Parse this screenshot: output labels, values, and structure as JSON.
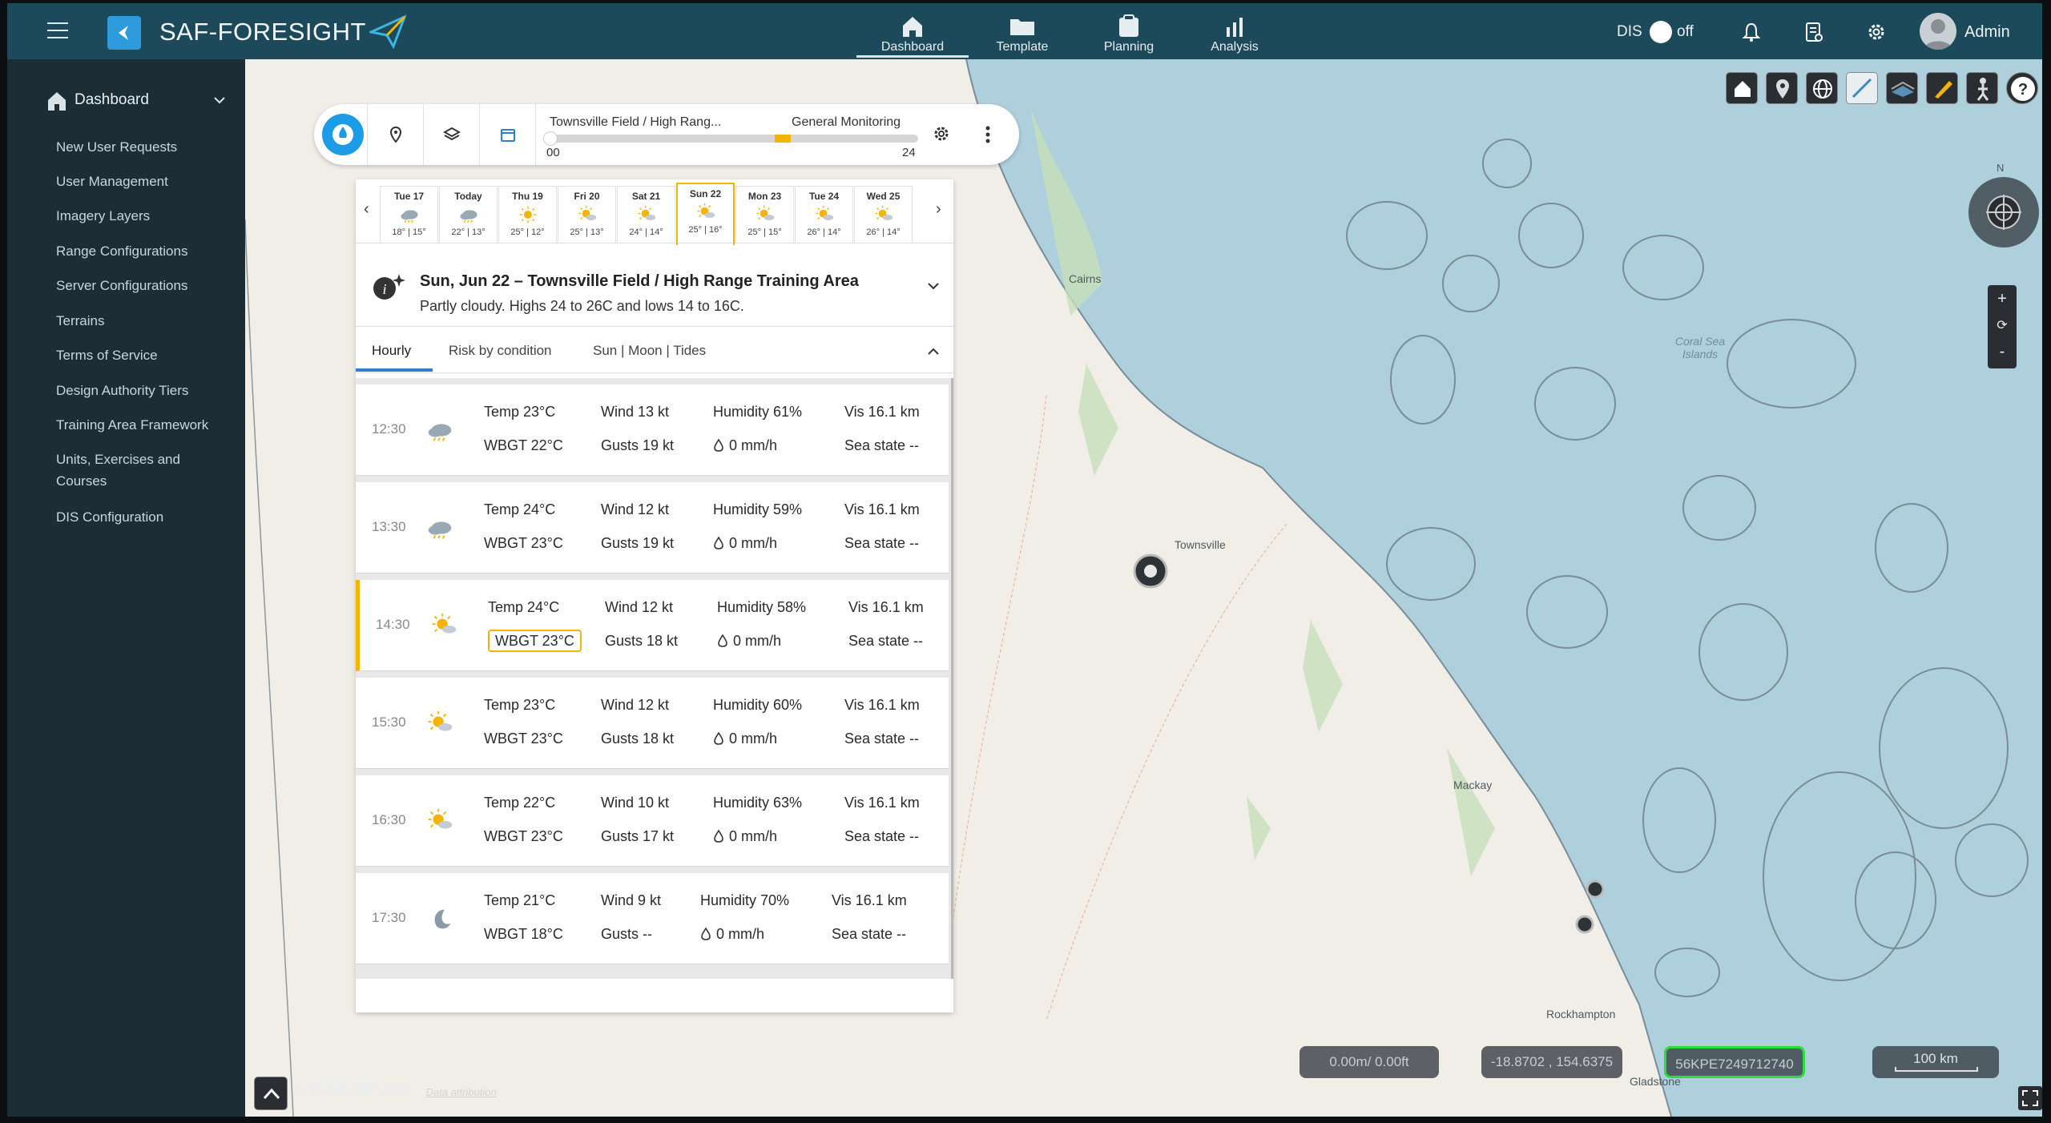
{
  "header": {
    "app_title": "SAF-FORESIGHT",
    "nav": [
      {
        "label": "Dashboard",
        "icon": "home-icon",
        "active": true
      },
      {
        "label": "Template",
        "icon": "folder-icon",
        "active": false
      },
      {
        "label": "Planning",
        "icon": "clipboard-icon",
        "active": false
      },
      {
        "label": "Analysis",
        "icon": "bar-chart-icon",
        "active": false
      }
    ],
    "dis_label": "DIS",
    "dis_toggle": "off",
    "user": "Admin"
  },
  "sidebar": {
    "section": "Dashboard",
    "items": [
      "New User Requests",
      "User Management",
      "Imagery Layers",
      "Range Configurations",
      "Server Configurations",
      "Terrains",
      "Terms of Service",
      "Design Authority Tiers",
      "Training Area Framework",
      "Units, Exercises and Courses",
      "DIS Configuration"
    ]
  },
  "controls": {
    "range_name": "Townsville Field / High Rang...",
    "mode": "General Monitoring",
    "slider_start": "00",
    "slider_end": "24"
  },
  "days": [
    {
      "label": "Tue 17",
      "temps": "18° | 15°",
      "icon": "cloud-icon"
    },
    {
      "label": "Today",
      "temps": "22° | 13°",
      "icon": "cloud-icon"
    },
    {
      "label": "Thu 19",
      "temps": "25° | 12°",
      "icon": "sun-icon"
    },
    {
      "label": "Fri 20",
      "temps": "25° | 13°",
      "icon": "partly-cloudy-icon"
    },
    {
      "label": "Sat 21",
      "temps": "24° | 14°",
      "icon": "partly-cloudy-icon"
    },
    {
      "label": "Sun 22",
      "temps": "25° | 16°",
      "icon": "partly-cloudy-icon",
      "selected": true
    },
    {
      "label": "Mon 23",
      "temps": "25° | 15°",
      "icon": "partly-cloudy-icon"
    },
    {
      "label": "Tue 24",
      "temps": "26° | 14°",
      "icon": "partly-cloudy-icon"
    },
    {
      "label": "Wed 25",
      "temps": "26° | 14°",
      "icon": "partly-cloudy-icon"
    }
  ],
  "summary": {
    "title": "Sun, Jun 22 – Townsville Field / High Range Training Area",
    "desc": "Partly cloudy. Highs 24 to 26C and lows 14 to 16C."
  },
  "tabs": [
    "Hourly",
    "Risk by condition",
    "Sun | Moon | Tides"
  ],
  "hourly": [
    {
      "time": "12:30",
      "temp": "Temp 23°C",
      "wbgt": "WBGT 22°C",
      "wind": "Wind 13 kt",
      "gusts": "Gusts 19 kt",
      "humidity": "Humidity 61%",
      "rain": "0 mm/h",
      "vis": "Vis 16.1 km",
      "sea": "Sea state --"
    },
    {
      "time": "13:30",
      "temp": "Temp 24°C",
      "wbgt": "WBGT 23°C",
      "wind": "Wind 12 kt",
      "gusts": "Gusts 19 kt",
      "humidity": "Humidity 59%",
      "rain": "0 mm/h",
      "vis": "Vis 16.1 km",
      "sea": "Sea state --"
    },
    {
      "time": "14:30",
      "temp": "Temp 24°C",
      "wbgt": "WBGT 23°C",
      "wind": "Wind 12 kt",
      "gusts": "Gusts 18 kt",
      "humidity": "Humidity 58%",
      "rain": "0 mm/h",
      "vis": "Vis 16.1 km",
      "sea": "Sea state --",
      "selected": true
    },
    {
      "time": "15:30",
      "temp": "Temp 23°C",
      "wbgt": "WBGT 23°C",
      "wind": "Wind 12 kt",
      "gusts": "Gusts 18 kt",
      "humidity": "Humidity 60%",
      "rain": "0 mm/h",
      "vis": "Vis 16.1 km",
      "sea": "Sea state --"
    },
    {
      "time": "16:30",
      "temp": "Temp 22°C",
      "wbgt": "WBGT 23°C",
      "wind": "Wind 10 kt",
      "gusts": "Gusts 17 kt",
      "humidity": "Humidity 63%",
      "rain": "0 mm/h",
      "vis": "Vis 16.1 km",
      "sea": "Sea state --"
    },
    {
      "time": "17:30",
      "temp": "Temp 21°C",
      "wbgt": "WBGT 18°C",
      "wind": "Wind 9 kt",
      "gusts": "Gusts --",
      "humidity": "Humidity 70%",
      "rain": "0 mm/h",
      "vis": "Vis 16.1 km",
      "sea": "Sea state --"
    }
  ],
  "map": {
    "labels": [
      "Cairns",
      "Townsville",
      "Mackay",
      "Rockhampton",
      "Gladstone"
    ],
    "water_label": "Coral Sea Islands",
    "compass": "N",
    "height_readout": "0.00m/ 0.00ft",
    "coords_readout": "-18.8702 , 154.6375",
    "grid_readout": "56KPE7249712740",
    "scale_label": "100 km",
    "attribution": "Data attribution",
    "cesium_logo": "CESIUM ion"
  },
  "colors": {
    "header_bg": "#1d4a5a",
    "sidebar_bg": "#1c2d35",
    "accent_blue": "#1c9ce6",
    "selected_gold": "#f4b400",
    "grid_green": "#2fdb3a"
  }
}
